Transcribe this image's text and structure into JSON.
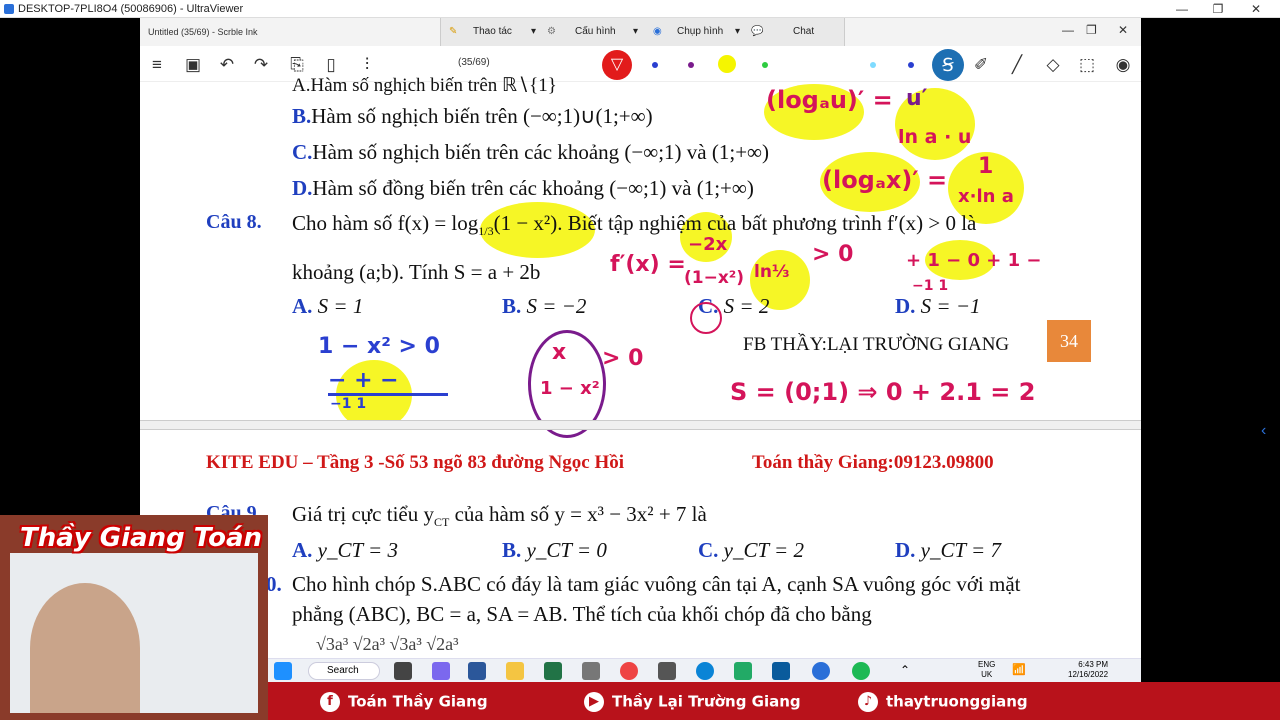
{
  "uv_window": {
    "title": "DESKTOP-7PLI8O4 (50086906) - UltraViewer",
    "min": "—",
    "max": "❐",
    "close": "✕"
  },
  "scrble": {
    "title": "Untitled (35/69) - Scrble Ink",
    "page_counter": "(35/69)",
    "uv_menu": {
      "thao_tac": "Thao tác",
      "cau_hinh": "Cấu hình",
      "chup_hinh": "Chụp hình",
      "chat": "Chat"
    }
  },
  "doc": {
    "line_a_partial": "A.Hàm số nghịch biến trên ℝ∖{1}",
    "opt_b_lbl": "B.",
    "opt_b": "Hàm số nghịch biến trên (−∞;1)∪(1;+∞)",
    "opt_c_lbl": "C.",
    "opt_c": "Hàm số nghịch biến trên các khoảng (−∞;1) và (1;+∞)",
    "opt_d_lbl": "D.",
    "opt_d": "Hàm số đồng biến trên các khoảng (−∞;1) và (1;+∞)",
    "q8_lbl": "Câu 8.",
    "q8_text1": "Cho hàm số f(x) = log",
    "q8_sub": "1/3",
    "q8_text2": "(1 − x²). Biết tập nghiệm của bất phương trình f′(x) > 0 là",
    "q8_text3": "khoảng (a;b). Tính S = a + 2b",
    "q8_a_lbl": "A.",
    "q8_a": "S = 1",
    "q8_b_lbl": "B.",
    "q8_b": "S = −2",
    "q8_c_lbl": "C.",
    "q8_c": "S = 2",
    "q8_d_lbl": "D.",
    "q8_d": "S = −1",
    "fb": "FB THẦY:LẠI TRƯỜNG GIANG",
    "page_no": "34",
    "header_left": "KITE EDU – Tầng 3 -Số 53 ngõ 83 đường Ngọc Hồi",
    "header_right": "Toán thầy Giang:09123.09800",
    "q9_lbl": "Câu 9.",
    "q9_text": "Giá trị cực tiểu y",
    "q9_sub": "CT",
    "q9_text2": "của hàm số y = x³ − 3x² + 7 là",
    "q9_a_lbl": "A.",
    "q9_a": "y_CT = 3",
    "q9_b_lbl": "B.",
    "q9_b": "y_CT = 0",
    "q9_c_lbl": "C.",
    "q9_c": "y_CT = 2",
    "q9_d_lbl": "D.",
    "q9_d": "y_CT = 7",
    "q10_num": "0.",
    "q10_text1": "Cho hình chóp S.ABC có đáy là tam giác vuông cân tại A, cạnh SA vuông góc với mặt",
    "q10_text2": "phẳng (ABC), BC = a, SA = AB. Thể tích của khối chóp đã cho bằng",
    "q10_partial": "√3a³          √2a³          √3a³          √2a³"
  },
  "ink": {
    "loga_u": "(logₐu)′ =",
    "u_prime": "u′",
    "ln_a_u": "ln a · u",
    "loga_x": "(logₐx)′ =",
    "one": "1",
    "x_ln_a": "x·ln a",
    "fprime": "f′(x) =",
    "frac_top": "−2x",
    "frac_bot": "(1−x²)",
    "ln13": "ln⅓",
    "gt0": "> 0",
    "sign_row": "+ 1 − 0 + 1 −",
    "sign_bot": "−1    1",
    "ineq": "1 − x² > 0",
    "numline": "−  +  −",
    "numline_bot": "−1      1",
    "frac2_top": "x",
    "frac2_bot": "1 − x²",
    "frac2_gt": "> 0",
    "answer": "S = (0;1) ⇒ 0 + 2.1 = 2"
  },
  "taskbar": {
    "search": "Search",
    "lang": "ENG",
    "region": "UK",
    "time": "6:43 PM",
    "date": "12/16/2022"
  },
  "social": {
    "fb": "Toán Thầy Giang",
    "yt": "Thầy Lại Trường Giang",
    "tt": "thaytruonggiang"
  },
  "cam": {
    "name": "Thầy Giang Toán"
  },
  "colors": {
    "accent": "#d01818",
    "label_blue": "#1f3fbf",
    "orange": "#e8883a",
    "highlight": "#f5f500"
  }
}
